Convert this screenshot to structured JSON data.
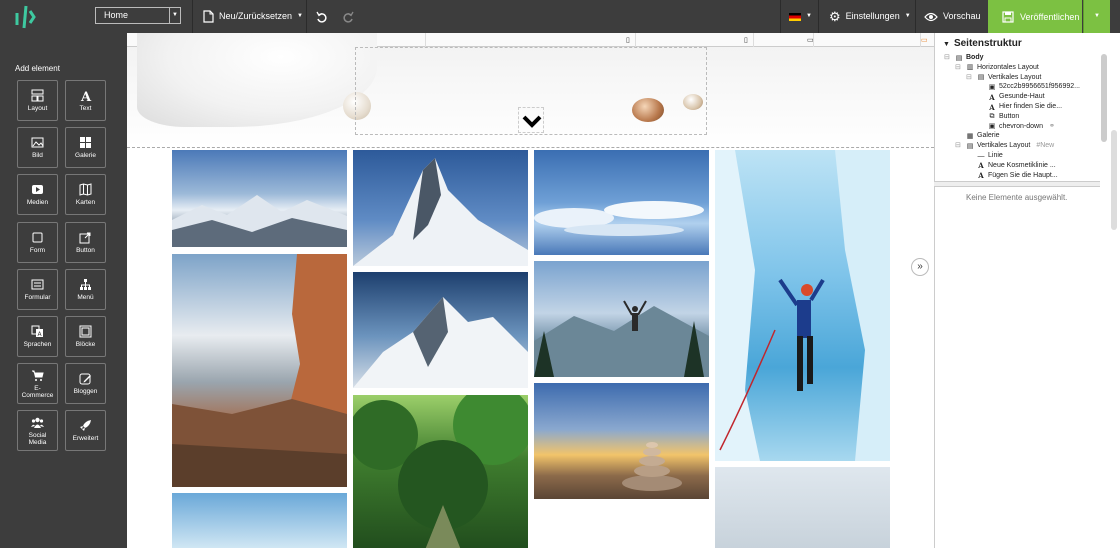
{
  "topbar": {
    "page_select": "Home",
    "new_reset": "Neu/Zurücksetzen",
    "settings": "Einstellungen",
    "preview": "Vorschau",
    "publish": "Veröffentlichen"
  },
  "sidebar": {
    "title": "Add element",
    "items": [
      {
        "label": "Layout",
        "icon": "layout-icon"
      },
      {
        "label": "Text",
        "icon": "text-icon"
      },
      {
        "label": "Bild",
        "icon": "image-icon"
      },
      {
        "label": "Galerie",
        "icon": "gallery-icon"
      },
      {
        "label": "Medien",
        "icon": "video-icon"
      },
      {
        "label": "Karten",
        "icon": "map-icon"
      },
      {
        "label": "Form",
        "icon": "checkbox-icon"
      },
      {
        "label": "Button",
        "icon": "button-share-icon"
      },
      {
        "label": "Formular",
        "icon": "form-icon"
      },
      {
        "label": "Menü",
        "icon": "sitemap-icon"
      },
      {
        "label": "Sprachen",
        "icon": "language-icon"
      },
      {
        "label": "Blöcke",
        "icon": "blocks-icon"
      },
      {
        "label": "E-Commerce",
        "icon": "cart-icon"
      },
      {
        "label": "Bloggen",
        "icon": "edit-icon"
      },
      {
        "label": "Social Media",
        "icon": "users-icon"
      },
      {
        "label": "Erweitert",
        "icon": "rocket-icon"
      }
    ]
  },
  "structure": {
    "title": "Seitenstruktur",
    "nodes": [
      {
        "label": "Body",
        "level": 0,
        "icon": "layout-icon",
        "bold": true
      },
      {
        "label": "Horizontales Layout",
        "level": 1,
        "icon": "columns-icon"
      },
      {
        "label": "Vertikales Layout",
        "level": 2,
        "icon": "rows-icon"
      },
      {
        "label": "52cc2b9956651f956992...",
        "level": 3,
        "icon": "image-icon"
      },
      {
        "label": "Gesunde-Haut",
        "level": 3,
        "icon": "text-icon"
      },
      {
        "label": "Hier finden Sie die...",
        "level": 3,
        "icon": "text-icon"
      },
      {
        "label": "Button",
        "level": 3,
        "icon": "button-share-icon"
      },
      {
        "label": "chevron-down",
        "level": 3,
        "icon": "image-icon",
        "link": true
      },
      {
        "label": "Galerie",
        "level": 1,
        "icon": "gallery-icon"
      },
      {
        "label": "Vertikales Layout",
        "level": 1,
        "icon": "rows-icon",
        "tag": "#New"
      },
      {
        "label": "Linie",
        "level": 2,
        "icon": "line-icon"
      },
      {
        "label": "Neue Kosmetiklinie ...",
        "level": 2,
        "icon": "text-icon"
      },
      {
        "label": "Fügen Sie die Haupt...",
        "level": 2,
        "icon": "text-icon"
      }
    ],
    "empty_message": "Keine Elemente ausgewählt."
  },
  "colors": {
    "topbar": "#3d3d3d",
    "publish": "#7cc142",
    "sidebar": "#3d3d3d"
  }
}
